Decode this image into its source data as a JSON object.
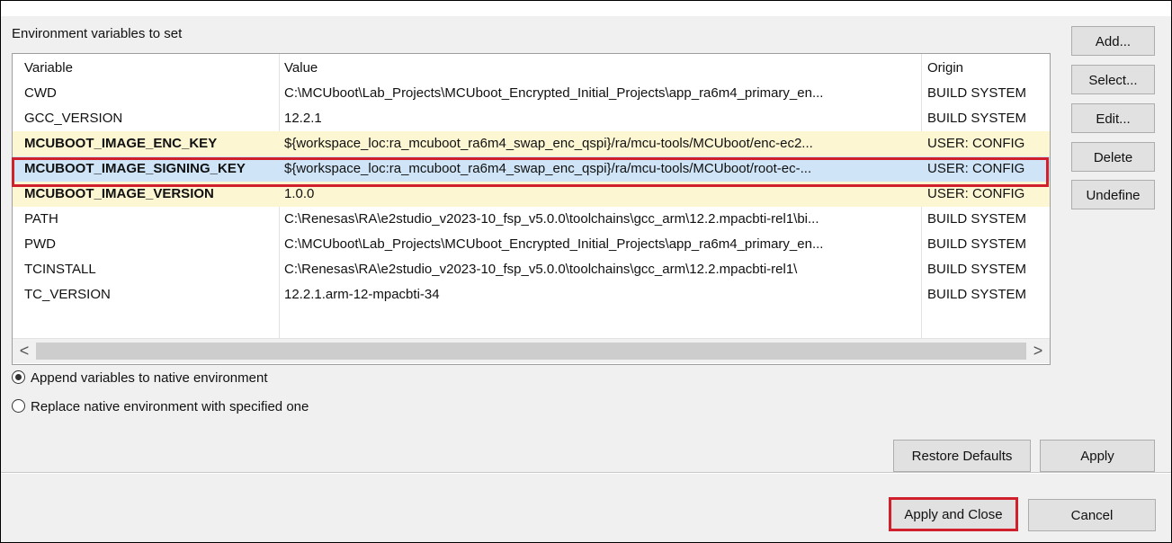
{
  "section_title": "Environment variables to set",
  "table": {
    "headers": [
      "Variable",
      "Value",
      "Origin"
    ],
    "rows": [
      {
        "variable": "CWD",
        "value": "C:\\MCUboot\\Lab_Projects\\MCUboot_Encrypted_Initial_Projects\\app_ra6m4_primary_en...",
        "origin": "BUILD SYSTEM"
      },
      {
        "variable": "GCC_VERSION",
        "value": "12.2.1",
        "origin": "BUILD SYSTEM"
      },
      {
        "variable": "MCUBOOT_IMAGE_ENC_KEY",
        "value": "${workspace_loc:ra_mcuboot_ra6m4_swap_enc_qspi}/ra/mcu-tools/MCUboot/enc-ec2...",
        "origin": "USER: CONFIG"
      },
      {
        "variable": "MCUBOOT_IMAGE_SIGNING_KEY",
        "value": "${workspace_loc:ra_mcuboot_ra6m4_swap_enc_qspi}/ra/mcu-tools/MCUboot/root-ec-...",
        "origin": "USER: CONFIG"
      },
      {
        "variable": "MCUBOOT_IMAGE_VERSION",
        "value": "1.0.0",
        "origin": "USER: CONFIG"
      },
      {
        "variable": "PATH",
        "value": "C:\\Renesas\\RA\\e2studio_v2023-10_fsp_v5.0.0\\toolchains\\gcc_arm\\12.2.mpacbti-rel1\\bi...",
        "origin": "BUILD SYSTEM"
      },
      {
        "variable": "PWD",
        "value": "C:\\MCUboot\\Lab_Projects\\MCUboot_Encrypted_Initial_Projects\\app_ra6m4_primary_en...",
        "origin": "BUILD SYSTEM"
      },
      {
        "variable": "TCINSTALL",
        "value": "C:\\Renesas\\RA\\e2studio_v2023-10_fsp_v5.0.0\\toolchains\\gcc_arm\\12.2.mpacbti-rel1\\",
        "origin": "BUILD SYSTEM"
      },
      {
        "variable": "TC_VERSION",
        "value": "12.2.1.arm-12-mpacbti-34",
        "origin": "BUILD SYSTEM"
      }
    ]
  },
  "side_buttons": {
    "add": "Add...",
    "select": "Select...",
    "edit": "Edit...",
    "delete": "Delete",
    "undefine": "Undefine"
  },
  "options": {
    "append": "Append variables to native environment",
    "replace": "Replace native environment with specified one",
    "selected": "append"
  },
  "buttons": {
    "restore_defaults": "Restore Defaults",
    "apply": "Apply",
    "apply_and_close": "Apply and Close",
    "cancel": "Cancel"
  },
  "scroll_arrows": {
    "left": "<",
    "right": ">"
  },
  "colors": {
    "user_row": "#fcf6d2",
    "selected_row": "#cfe5f7",
    "highlight": "#d0202c"
  }
}
